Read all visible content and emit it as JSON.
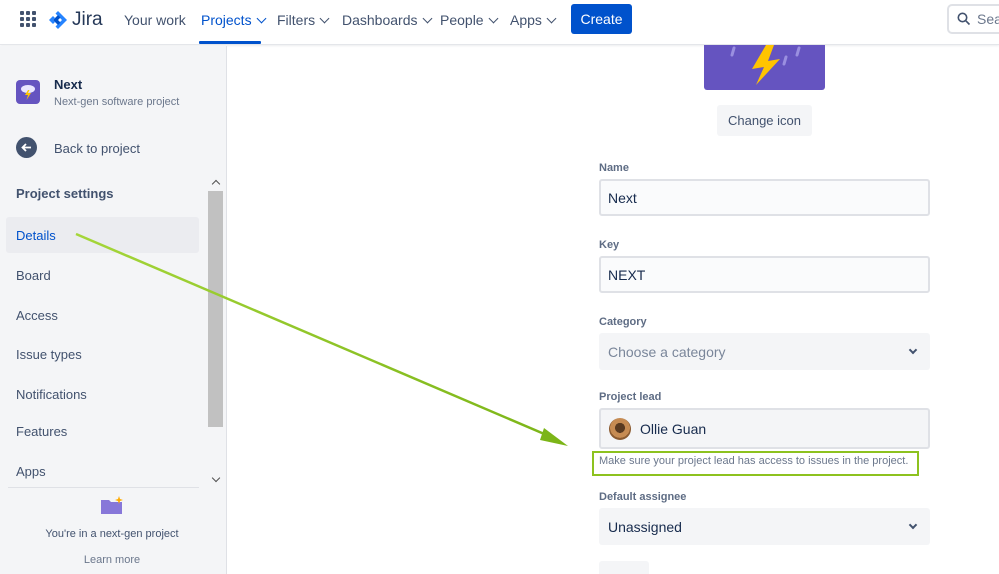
{
  "nav": {
    "product": "Jira",
    "items": [
      {
        "label": "Your work",
        "dropdown": false
      },
      {
        "label": "Projects",
        "dropdown": true,
        "active": true
      },
      {
        "label": "Filters",
        "dropdown": true
      },
      {
        "label": "Dashboards",
        "dropdown": true
      },
      {
        "label": "People",
        "dropdown": true
      },
      {
        "label": "Apps",
        "dropdown": true
      }
    ],
    "create_label": "Create",
    "search_placeholder": "Sea"
  },
  "sidebar": {
    "project_name": "Next",
    "project_type": "Next-gen software project",
    "back_label": "Back to project",
    "section_title": "Project settings",
    "items": [
      {
        "label": "Details",
        "selected": true
      },
      {
        "label": "Board"
      },
      {
        "label": "Access"
      },
      {
        "label": "Issue types"
      },
      {
        "label": "Notifications"
      },
      {
        "label": "Features"
      },
      {
        "label": "Apps"
      }
    ],
    "footer_text": "You're in a next-gen project",
    "learn_more": "Learn more"
  },
  "main": {
    "change_icon_label": "Change icon",
    "name_label": "Name",
    "name_value": "Next",
    "key_label": "Key",
    "key_value": "NEXT",
    "category_label": "Category",
    "category_placeholder": "Choose a category",
    "lead_label": "Project lead",
    "lead_value": "Ollie Guan",
    "lead_help": "Make sure your project lead has access to issues in the project.",
    "assignee_label": "Default assignee",
    "assignee_value": "Unassigned"
  },
  "colors": {
    "brand": "#0052cc",
    "project_icon": "#6554c0",
    "annotation": "#8dc21f"
  }
}
